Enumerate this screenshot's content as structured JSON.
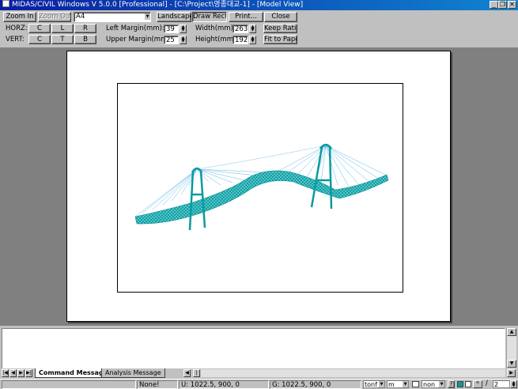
{
  "window": {
    "title": "MIDAS/CIVIL Windows V 5.0.0 [Professional] - [C:\\Project\\영종대교-1] - [Model View]"
  },
  "toolbar": {
    "zoom_in": "Zoom In",
    "zoom_out": "Zoom Out",
    "paper_size": "A4",
    "landscape": "Landscape",
    "draw_rect": "Draw Rect.",
    "print": "Print...",
    "close": "Close",
    "horz_label": "HORZ:",
    "vert_label": "VERT:",
    "horz_c": "C",
    "horz_l": "L",
    "horz_r": "R",
    "vert_c": "C",
    "vert_t": "T",
    "vert_b": "B",
    "left_margin_label": "Left Margin(mm):",
    "left_margin_value": "39",
    "upper_margin_label": "Upper Margin(mm):",
    "upper_margin_value": "25",
    "width_label": "Width(mm):",
    "width_value": "263",
    "height_label": "Height(mm):",
    "height_value": "192",
    "keep_ratio": "Keep Ratio",
    "fit_to_paper": "Fit to Paper"
  },
  "message_tabs": {
    "command": "Command Message",
    "analysis": "Analysis Message"
  },
  "status": {
    "selection": "None!",
    "u_coord": "U: 1022.5, 900, 0",
    "g_coord": "G: 1022.5, 900, 0",
    "force_unit": "tonf",
    "length_unit": "m",
    "filter": "non",
    "question": "?",
    "page_sep": "/",
    "page_value": "2"
  },
  "colors": {
    "model": "#0a9aa0",
    "cable": "#5fb8e8"
  }
}
